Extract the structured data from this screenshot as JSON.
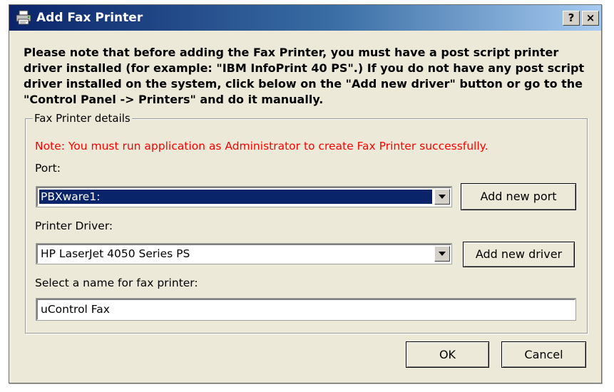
{
  "window": {
    "title": "Add Fax Printer",
    "help_label": "?",
    "close_label": "×",
    "title_gradient_start": "#0a246a"
  },
  "intro": {
    "text": "Please note that before adding the Fax Printer, you must have a post script printer driver installed (for example: \"IBM InfoPrint 40 PS\".) If you do not have any post script driver installed on the system, click below on the \"Add new driver\" button or go to the \"Control Panel -> Printers\" and do it manually."
  },
  "group": {
    "legend": "Fax Printer details",
    "note": "Note: You must run application as Administrator to create Fax Printer successfully.",
    "note_color": "#ff0000",
    "port": {
      "label": "Port:",
      "value": "PBXware1:",
      "add_button": "Add new port"
    },
    "driver": {
      "label": "Printer Driver:",
      "value": "HP LaserJet 4050 Series PS",
      "add_button": "Add new driver"
    },
    "name": {
      "label": "Select a name for fax printer:",
      "value": "uControl Fax"
    }
  },
  "footer": {
    "ok_label": "OK",
    "cancel_label": "Cancel"
  }
}
